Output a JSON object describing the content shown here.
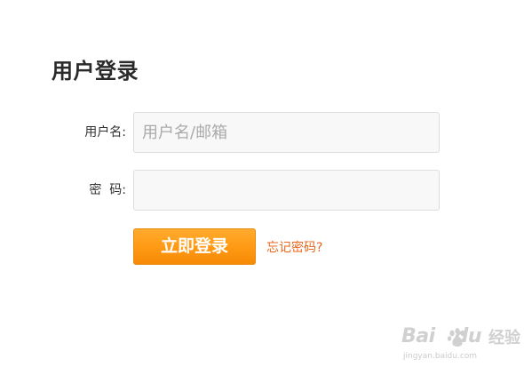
{
  "page": {
    "title": "用户登录"
  },
  "form": {
    "username_label": "用户名:",
    "username_placeholder": "用户名/邮箱",
    "username_value": "",
    "password_label": "密  码:",
    "password_value": "",
    "login_button": "立即登录",
    "forgot_link": "忘记密码?"
  },
  "watermark": {
    "brand": "Bai",
    "brand_suffix": "du",
    "name": "经验",
    "url": "jingyan.baidu.com"
  },
  "colors": {
    "button_orange": "#ff9a15",
    "link_orange": "#e8661b",
    "input_bg": "#f8f8f8",
    "input_border": "#dddddd",
    "title_text": "#2a2a2a"
  },
  "icons": {
    "watermark_logo": "baidu-paw-icon"
  }
}
